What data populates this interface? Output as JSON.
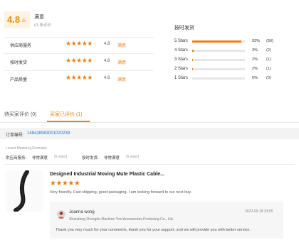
{
  "overall": {
    "score": "4.8",
    "denominator": "/5",
    "satisfaction_label": "满意",
    "review_count": "63 条评价"
  },
  "rows": [
    {
      "label": "供应商服务",
      "stars": "★★★★★",
      "score": "4.8",
      "tag": "满意"
    },
    {
      "label": "按时发货",
      "stars": "★★★★★",
      "score": "4.8",
      "tag": "满意"
    },
    {
      "label": "产品质量",
      "stars": "★★★★★",
      "score": "4.8",
      "tag": "满意"
    }
  ],
  "ontime": {
    "title": "按时发货",
    "distribution": [
      {
        "label": "5 Stars",
        "percent": "93%",
        "count": "(59)",
        "fill": 0.93
      },
      {
        "label": "4 Stars",
        "percent": "3%",
        "count": "(2)",
        "fill": 0.03
      },
      {
        "label": "3 Stars",
        "percent": "2%",
        "count": "(1)",
        "fill": 0.02
      },
      {
        "label": "2 Stars",
        "percent": "2%",
        "count": "(1)",
        "fill": 0.02
      },
      {
        "label": "1 Stars",
        "percent": "0%",
        "count": "(0)",
        "fill": 0.0
      }
    ]
  },
  "tabs": [
    {
      "label": "待买家评价 (0)",
      "active": false
    },
    {
      "label": "买家已评价 (1)",
      "active": true
    }
  ],
  "order": {
    "label": "订单编号:",
    "number": "148428983001020239"
  },
  "review": {
    "buyer": "Lorant Mesterey,Germany",
    "svc_label": "供应商服务:",
    "svc_value": "非常满意",
    "svc_small": "(5 stars)",
    "ontime_label": "按时发货:",
    "ontime_value": "非常满意",
    "ontime_small": "(5 stars)",
    "product_title": "Designed Industrial Moving Mute Plastic Cable...",
    "stars": "★★★★★",
    "text": "Very friendly. Fast shipping, good packaging. I am looking forward to our next buy."
  },
  "reply": {
    "name": "Joanna wong",
    "date": "2022-09-18 23:05",
    "company": "Shandong Zhongde Machine Tool Accessories Producing Co., Ltd.",
    "text": "Thank you very much for your comments, thank you for your support, and we will provide you with better service."
  },
  "colors": {
    "accent": "#f07c12",
    "link": "#2a6ecb"
  }
}
